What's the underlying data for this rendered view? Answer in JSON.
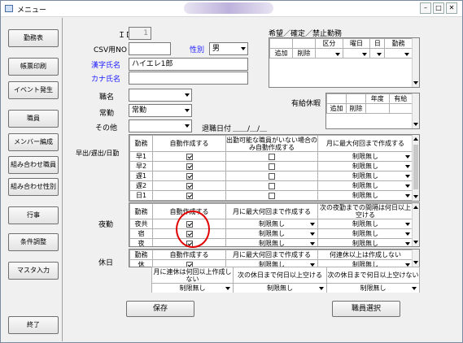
{
  "window": {
    "title": "メニュー"
  },
  "sidebar": {
    "items": [
      "勤務表",
      "帳票印刷",
      "イベント発生",
      "職員",
      "メンバー編成",
      "組み合わせ職員",
      "組み合わせ性別",
      "行事",
      "条件調整",
      "マスタ入力",
      "終了"
    ]
  },
  "form": {
    "id_label": "ＩＤ",
    "id_value": "1",
    "csv_label": "CSV用NO",
    "csv_value": "",
    "gender_label": "性別",
    "gender_value": "男",
    "kanji_label": "漢字氏名",
    "kanji_value": "ハイエレ1郎",
    "kana_label": "カナ氏名",
    "kana_value": "",
    "post_label": "職名",
    "post_value": "",
    "work_label": "常勤",
    "work_value": "常勤",
    "other_label": "その他",
    "other_value": "",
    "retire_label": "退職日付",
    "retire_value": "＿＿/＿/＿"
  },
  "wish": {
    "title": "希望／確定／禁止勤務",
    "headers": [
      "",
      "",
      "区分",
      "曜日",
      "日",
      "勤務"
    ],
    "row": [
      "追加",
      "削除"
    ]
  },
  "leave": {
    "title": "有給休暇",
    "headers": [
      "",
      "",
      "年度",
      "有給"
    ],
    "row": [
      "追加",
      "削除"
    ]
  },
  "early": {
    "side_label": "早出/遅出/日勤",
    "headers": [
      "勤務",
      "自動作成する",
      "出勤可能な職員がいない場合のみ自動作成する",
      "月に最大何回まで作成する"
    ],
    "rows": [
      {
        "shift": "早1",
        "auto": true,
        "only": false,
        "max": "制限無し"
      },
      {
        "shift": "早2",
        "auto": true,
        "only": false,
        "max": "制限無し"
      },
      {
        "shift": "遅1",
        "auto": true,
        "only": false,
        "max": "制限無し"
      },
      {
        "shift": "遅2",
        "auto": true,
        "only": false,
        "max": "制限無し"
      },
      {
        "shift": "日1",
        "auto": true,
        "only": false,
        "max": "制限無し"
      }
    ]
  },
  "night": {
    "side_label": "夜勤",
    "headers": [
      "勤務",
      "自動作成する",
      "月に最大何回まで作成する",
      "次の夜勤までの間隔は何日以上空ける"
    ],
    "rows": [
      {
        "shift": "夜共",
        "auto": true,
        "max": "制限無し",
        "gap": "制限無し"
      },
      {
        "shift": "宿",
        "auto": true,
        "max": "制限無し",
        "gap": "制限無し"
      },
      {
        "shift": "夜",
        "auto": true,
        "max": "制限無し",
        "gap": "制限無し"
      }
    ]
  },
  "holiday": {
    "side_label": "休日",
    "headers": [
      "勤務",
      "自動作成する",
      "月に最大何回まで作成する",
      "何連休以上は作成しない"
    ],
    "row": {
      "shift": "休",
      "auto": true,
      "max": "制限無し",
      "consec": "制限無し"
    },
    "sub_headers": [
      "月に連休は何回以上作成しない",
      "次の休日まで何日以上空ける",
      "次の休日まで何日以上空けない"
    ],
    "sub_values": [
      "制限無し",
      "制限無し",
      "制限無し"
    ]
  },
  "buttons": {
    "save": "保存",
    "select_staff": "職員選択"
  }
}
